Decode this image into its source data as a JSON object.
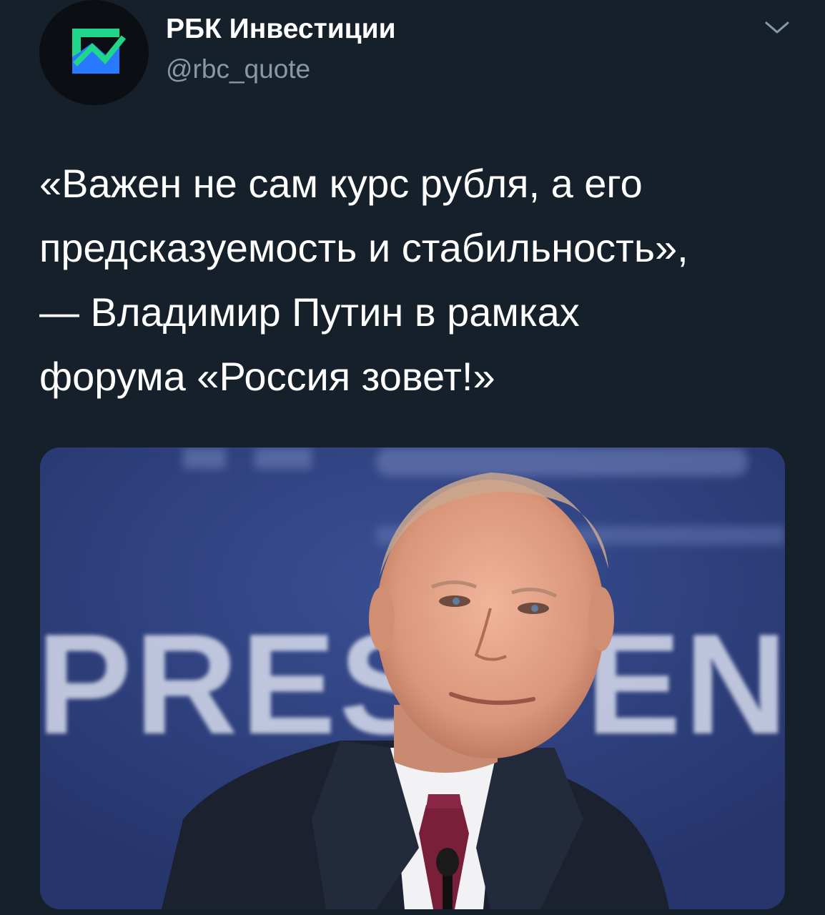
{
  "tweet": {
    "author_name": "РБК Инвестиции",
    "author_handle": "@rbc_quote",
    "avatar_icon": "rbc-investments-chart-logo-icon",
    "menu_icon": "chevron-down-icon",
    "text_lines": [
      "«Важен не сам курс рубля, а его",
      "предсказуемость и стабильность»,",
      "— Владимир Путин в рамках",
      "форума «Россия зовет!»"
    ],
    "media": {
      "backdrop_text": "PRESIDENT",
      "description_icon": "photo-icon"
    }
  },
  "colors": {
    "background": "#15202b",
    "text": "#ffffff",
    "secondary_text": "#8899a6",
    "logo_green": "#1fd68a",
    "logo_blue": "#2979ff",
    "backdrop_blue": "#2c3d78"
  }
}
